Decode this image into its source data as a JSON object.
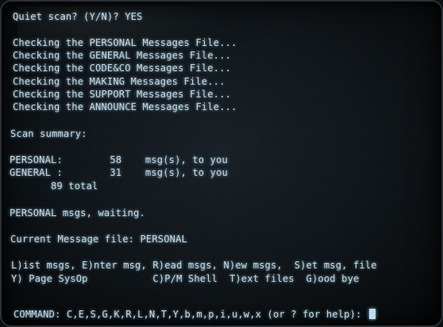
{
  "prompt": {
    "question": "Quiet scan? (Y/N)? YES"
  },
  "scan": {
    "checking": [
      "Checking the PERSONAL Messages File...",
      "Checking the GENERAL Messages File...",
      "Checking the CODE&CO Messages File...",
      "Checking the MAKING Messages File...",
      "Checking the SUPPORT Messages File...",
      "Checking the ANNOUNCE Messages File..."
    ]
  },
  "summary": {
    "heading": "Scan summary:",
    "rows": [
      "PERSONAL:        58    msg(s), to you",
      "GENERAL :        31    msg(s), to you"
    ],
    "total": "       89 total"
  },
  "status": {
    "waiting": "PERSONAL msgs, waiting.",
    "current_file": "Current Message file: PERSONAL"
  },
  "menu": {
    "line1": "L)ist msgs, E)nter msg, R)ead msgs, N)ew msgs,  S)et msg, file",
    "line2": "Y) Page SysOp           C)P/M Shell  T)ext files  G)ood bye"
  },
  "command": {
    "prompt": "COMMAND: C,E,S,G,K,R,L,N,T,Y,b,m,p,i,u,w,x (or ? for help): "
  },
  "colors": {
    "phosphor": "#c9dce6",
    "background": "#12181c"
  }
}
